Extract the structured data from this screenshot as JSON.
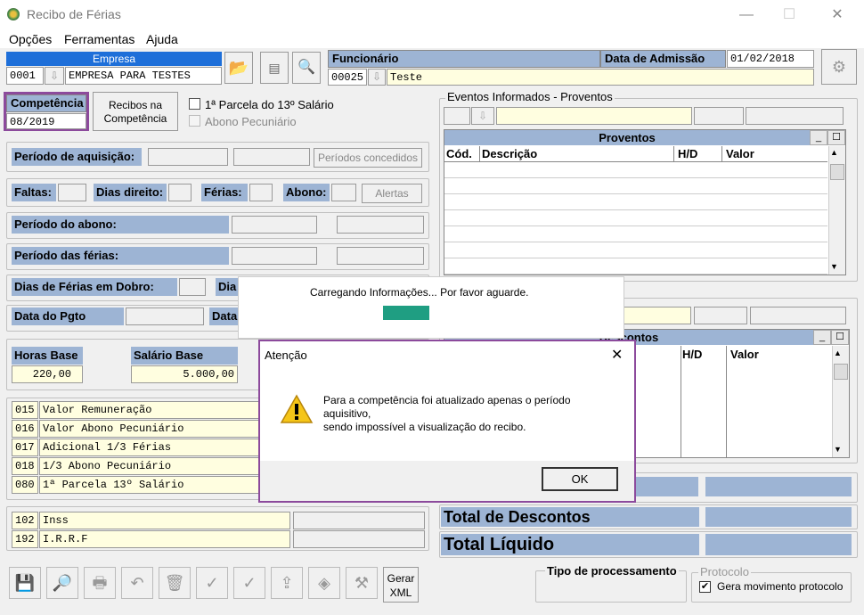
{
  "window": {
    "title": "Recibo de Férias",
    "min": "—",
    "max": "☐",
    "close": "✕"
  },
  "menu": [
    {
      "label": "Opções"
    },
    {
      "label": "Ferramentas"
    },
    {
      "label": "Ajuda"
    }
  ],
  "empresa": {
    "label": "Empresa",
    "code": "0001",
    "name": "EMPRESA PARA TESTES"
  },
  "funcionario": {
    "label": "Funcionário",
    "code": "00025",
    "name": "Teste",
    "admissao_label": "Data de Admissão",
    "admissao": "01/02/2018"
  },
  "competencia": {
    "label": "Competência",
    "value": "08/2019"
  },
  "recibos_btn": "Recibos na Competência",
  "parcela13": "1ª Parcela do 13º Salário",
  "abono_pec": "Abono Pecuniário",
  "periodo_aquisicao": "Período de aquisição:",
  "periodos_concedidos": "Períodos concedidos",
  "faltas": "Faltas:",
  "dias_direito": "Dias direito:",
  "ferias": "Férias:",
  "abono": "Abono:",
  "alertas": "Alertas",
  "periodo_abono": "Período do abono:",
  "periodo_ferias": "Período das férias:",
  "dias_dobro": "Dias de Férias em Dobro:",
  "dias_dobro2": "Dia",
  "data_pgto": "Data do Pgto",
  "data_pgto2": "Data",
  "horas_base": {
    "label": "Horas Base",
    "value": "220,00"
  },
  "salario_base": {
    "label": "Salário Base",
    "value": "5.000,00"
  },
  "proventos_list": [
    {
      "code": "015",
      "name": "Valor Remuneração"
    },
    {
      "code": "016",
      "name": "Valor Abono Pecuniário"
    },
    {
      "code": "017",
      "name": "Adicional 1/3 Férias"
    },
    {
      "code": "018",
      "name": "1/3 Abono Pecuniário"
    },
    {
      "code": "080",
      "name": "1ª Parcela 13º Salário"
    }
  ],
  "descontos_list": [
    {
      "code": "102",
      "name": "Inss"
    },
    {
      "code": "192",
      "name": "I.R.R.F"
    }
  ],
  "eventos_label": "Eventos Informados - Proventos",
  "proventos_grid": {
    "title": "Proventos",
    "cols": [
      "Cód.",
      "Descrição",
      "H/D",
      "Valor"
    ]
  },
  "descontos_grid": {
    "title": "Descontos",
    "cols": [
      "H/D",
      "Valor"
    ]
  },
  "total_descontos": "Total de Descontos",
  "total_liquido": "Total Líquido",
  "tipo_proc": "Tipo de processamento",
  "protocolo": "Protocolo",
  "gera_mov": "Gera movimento protocolo",
  "gerar_xml": "Gerar XML",
  "loading": {
    "text": "Carregando Informações... Por favor aguarde."
  },
  "alert": {
    "title": "Atenção",
    "line1": "Para a competência foi atualizado apenas o período",
    "line2": "aquisitivo,",
    "line3": "sendo impossível a visualização do recibo.",
    "ok": "OK"
  }
}
